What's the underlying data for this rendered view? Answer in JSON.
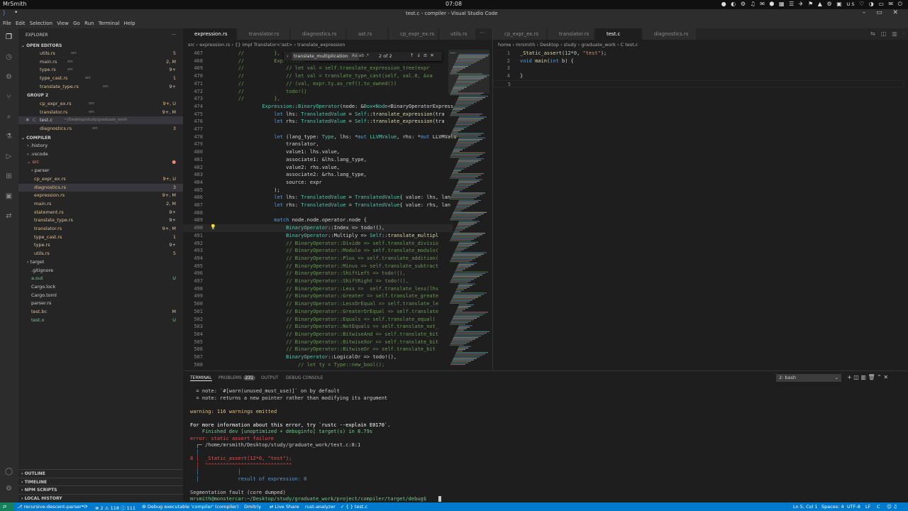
{
  "topbar": {
    "user": "MrSmith",
    "clock": "07:08",
    "tray": "● ◐ ⚙ ♫ ✉ ⬢ ▦ ☰ ✈ ⚑ ▲ ⚙ ▣ us ♡ ◑ ▭ ✉ ⏻"
  },
  "window": {
    "title": "test.c - compiler - Visual Studio Code",
    "controls": "– ▭ ✕"
  },
  "menu": [
    "File",
    "Edit",
    "Selection",
    "View",
    "Go",
    "Run",
    "Terminal",
    "Help"
  ],
  "sidebar": {
    "title": "EXPLORER",
    "more": "···",
    "open_editors_label": "OPEN EDITORS",
    "open_editors": [
      {
        "name": "utils.rs",
        "dir": "src",
        "badge": "5",
        "color": "#e2c08d"
      },
      {
        "name": "main.rs",
        "dir": "src",
        "badge": "2, M",
        "color": "#e2c08d"
      },
      {
        "name": "type.rs",
        "dir": "src",
        "badge": "9+",
        "color": "#e2c08d"
      },
      {
        "name": "type_cast.rs",
        "dir": "src",
        "badge": "1",
        "color": "#e2c08d"
      },
      {
        "name": "translate_type.rs",
        "dir": "src",
        "badge": "9+",
        "color": "#e2c08d"
      }
    ],
    "group2_label": "GROUP 2",
    "group2": [
      {
        "name": "cp_expr_ex.rs",
        "dir": "src",
        "badge": "9+, U",
        "color": "#e2c08d"
      },
      {
        "name": "translator.rs",
        "dir": "src",
        "badge": "9+, M",
        "color": "#e2c08d"
      },
      {
        "name": "test.c",
        "dir": "~/Desktop/study/graduate_work",
        "badge": "",
        "color": "#cccccc"
      },
      {
        "name": "diagnostics.rs",
        "dir": "src",
        "badge": "3",
        "color": "#e2c08d"
      }
    ],
    "compiler_label": "COMPILER",
    "tree": [
      {
        "name": "› .history",
        "badge": "",
        "color": "#cccccc",
        "indent": 12
      },
      {
        "name": "› .vscode",
        "badge": "",
        "color": "#cccccc",
        "indent": 12
      },
      {
        "name": "⌄ src",
        "badge": "●",
        "color": "#f48771",
        "indent": 12
      },
      {
        "name": "› parser",
        "badge": "",
        "color": "#cccccc",
        "indent": 18
      },
      {
        "name": "cp_expr_ex.rs",
        "badge": "9+, U",
        "color": "#e2c08d",
        "indent": 22
      },
      {
        "name": "diagnostics.rs",
        "badge": "3",
        "color": "#e2c08d",
        "indent": 22
      },
      {
        "name": "expression.rs",
        "badge": "9+, M",
        "color": "#e2c08d",
        "indent": 22
      },
      {
        "name": "main.rs",
        "badge": "2, M",
        "color": "#e2c08d",
        "indent": 22
      },
      {
        "name": "statement.rs",
        "badge": "9+",
        "color": "#e2c08d",
        "indent": 22
      },
      {
        "name": "translate_type.rs",
        "badge": "9+",
        "color": "#e2c08d",
        "indent": 22
      },
      {
        "name": "translator.rs",
        "badge": "9+, M",
        "color": "#e2c08d",
        "indent": 22
      },
      {
        "name": "type_cast.rs",
        "badge": "1",
        "color": "#e2c08d",
        "indent": 22
      },
      {
        "name": "type.rs",
        "badge": "9+",
        "color": "#e2c08d",
        "indent": 22
      },
      {
        "name": "utils.rs",
        "badge": "5",
        "color": "#e2c08d",
        "indent": 22
      },
      {
        "name": "› target",
        "badge": "",
        "color": "#cccccc",
        "indent": 12
      },
      {
        "name": ".gitignore",
        "badge": "",
        "color": "#cccccc",
        "indent": 18
      },
      {
        "name": "a.out",
        "badge": "U",
        "color": "#73c991",
        "indent": 18
      },
      {
        "name": "Cargo.lock",
        "badge": "",
        "color": "#cccccc",
        "indent": 18
      },
      {
        "name": "Cargo.toml",
        "badge": "",
        "color": "#cccccc",
        "indent": 18
      },
      {
        "name": "parser.rs",
        "badge": "",
        "color": "#cccccc",
        "indent": 18
      },
      {
        "name": "test.bc",
        "badge": "M",
        "color": "#e2c08d",
        "indent": 18
      },
      {
        "name": "test.o",
        "badge": "U",
        "color": "#73c991",
        "indent": 18
      }
    ],
    "bottom_sections": [
      "OUTLINE",
      "TIMELINE",
      "NPM SCRIPTS",
      "LOCAL HISTORY"
    ]
  },
  "editor1": {
    "tabs": [
      "expression.rs",
      "translator.rs",
      "diagnostics.rs",
      "ast.rs",
      "cp_expr_ex.rs",
      "utils.rs"
    ],
    "breadcrumb": "src  ›  expression.rs  ›  {} impl Translator<'ast>  ›  translate_expression",
    "find": {
      "query": "translate_multiplication",
      "result": "2 of 2",
      "options": "Aa  ab  .*"
    },
    "lines": [
      {
        "n": "467",
        "t": "        //          },"
      },
      {
        "n": "468",
        "t": "        //          Expression::..."
      },
      {
        "n": "469",
        "t": "        //              // let val = self.translate_expression_tree(expr"
      },
      {
        "n": "470",
        "t": "        //              // let val = translate_type_cast(self, val.0, &va"
      },
      {
        "n": "471",
        "t": "        //              // (val, expr.ty.as_ref().to_owned())"
      },
      {
        "n": "472",
        "t": "        //              todo!()"
      },
      {
        "n": "473",
        "t": "        //          },"
      },
      {
        "n": "474",
        "t": "                Expression::BinaryOperator(node: &Box<Node<BinaryOperatorExpress"
      },
      {
        "n": "475",
        "t": "                    let lhs: TranslatedValue = Self::translate_expression(tra"
      },
      {
        "n": "476",
        "t": "                    let rhs: TranslatedValue = Self::translate_expression(tra"
      },
      {
        "n": "477",
        "t": ""
      },
      {
        "n": "478",
        "t": "                    let (lang_type: Type, lhs: *mut LLVMValue, rhs: *mut LLVMValu"
      },
      {
        "n": "479",
        "t": "                        translator,"
      },
      {
        "n": "480",
        "t": "                        value1: lhs.value,"
      },
      {
        "n": "481",
        "t": "                        associate1: &lhs.lang_type,"
      },
      {
        "n": "482",
        "t": "                        value2: rhs.value,"
      },
      {
        "n": "483",
        "t": "                        associate2: &rhs.lang_type,"
      },
      {
        "n": "484",
        "t": "                        source: expr"
      },
      {
        "n": "485",
        "t": "                    );"
      },
      {
        "n": "486",
        "t": "                    let lhs: TranslatedValue = TranslatedValue{ value: lhs, lan"
      },
      {
        "n": "487",
        "t": "                    let rhs: TranslatedValue = TranslatedValue{ value: rhs, lan"
      },
      {
        "n": "488",
        "t": ""
      },
      {
        "n": "489",
        "t": "                    match node.node.operator.node {"
      },
      {
        "n": "490",
        "t": "                        BinaryOperator::Index => todo!(),"
      },
      {
        "n": "491",
        "t": "                        BinaryOperator::Multiply => Self::translate_multipl"
      },
      {
        "n": "492",
        "t": "                        // BinaryOperator::Divide => self.translate_divisio"
      },
      {
        "n": "493",
        "t": "                        // BinaryOperator::Modulo => self.translate_modulo("
      },
      {
        "n": "494",
        "t": "                        // BinaryOperator::Plus => self.translate_addition("
      },
      {
        "n": "495",
        "t": "                        // BinaryOperator::Minus => self.translate_subtract"
      },
      {
        "n": "496",
        "t": "                        // BinaryOperator::ShiftLeft => todo!(),"
      },
      {
        "n": "497",
        "t": "                        // BinaryOperator::ShiftRight => todo!(),"
      },
      {
        "n": "498",
        "t": "                        // BinaryOperator::Less =>  self.translate_less(lhs"
      },
      {
        "n": "499",
        "t": "                        // BinaryOperator::Greater => self.translate_greate"
      },
      {
        "n": "500",
        "t": "                        // BinaryOperator::LessOrEqual => self.translate_le"
      },
      {
        "n": "501",
        "t": "                        // BinaryOperator::GreaterOrEqual => self.translate"
      },
      {
        "n": "502",
        "t": "                        // BinaryOperator::Equals => self.translate_equal("
      },
      {
        "n": "503",
        "t": "                        // BinaryOperator::NotEquals => self.translate_not_"
      },
      {
        "n": "504",
        "t": "                        // BinaryOperator::BitwiseAnd => self.translate_bit"
      },
      {
        "n": "505",
        "t": "                        // BinaryOperator::BitwiseXor => self.translate_bit"
      },
      {
        "n": "506",
        "t": "                        // BinaryOperator::BitwiseOr => self.translate_bit"
      },
      {
        "n": "507",
        "t": "                        BinaryOperator::LogicalOr => todo!(),"
      },
      {
        "n": "508",
        "t": "                            // let ty = Type::new_bool();"
      }
    ]
  },
  "editor2": {
    "tabs": [
      "cp_expr_ex.rs",
      "translator.rs",
      "test.c",
      "diagnostics.rs"
    ],
    "breadcrumb": "home  ›  mrsmith  ›  Desktop  ›  study  ›  graduate_work  ›  C  test.c",
    "lines": [
      {
        "n": "1",
        "t": "_Static_assert(12*0, \"test\");"
      },
      {
        "n": "2",
        "t": "void main(int b) {"
      },
      {
        "n": "3",
        "t": ""
      },
      {
        "n": "4",
        "t": "}"
      },
      {
        "n": "5",
        "t": ""
      }
    ]
  },
  "panel": {
    "tabs": [
      "TERMINAL",
      "PROBLEMS",
      "OUTPUT",
      "DEBUG CONSOLE"
    ],
    "problems_count": "231",
    "shell": "2: bash",
    "shell_options": "⌄",
    "icons": "+   ◫   ▥   🗑   ⌃   ✕",
    "lines": [
      {
        "t": "  = note: `#[warn(unused_must_use)]` on by default",
        "c": "#cccccc"
      },
      {
        "t": "  = note: returns a new pointer rather than modifying its argument",
        "c": "#cccccc"
      },
      {
        "t": "",
        "c": "#cccccc"
      },
      {
        "t": "warning: 116 warnings emitted",
        "c": "#e5c07b"
      },
      {
        "t": "",
        "c": "#cccccc"
      },
      {
        "t": "For more information about this error, try `rustc --explain E0170`.",
        "c": "#ffffff"
      },
      {
        "t": "    Finished dev [unoptimized + debuginfo] target(s) in 8.79s",
        "c": "#73c991"
      },
      {
        "t": "error: static assert failure",
        "c": "#f14c4c"
      },
      {
        "t": "  ┌─ /home/mrsmith/Desktop/study/graduate_work/test.c:8:1",
        "c": "#cccccc"
      },
      {
        "t": "  │",
        "c": "#569cd6"
      },
      {
        "t": "8 │  _Static_assert(12*0, \"test\");",
        "c": "#f14c4c"
      },
      {
        "t": "  │  ^^^^^^^^^^^^^^^^^^^^^^^^^^^^^",
        "c": "#f14c4c"
      },
      {
        "t": "  │             │",
        "c": "#569cd6"
      },
      {
        "t": "  │             result of expression: 0",
        "c": "#569cd6"
      },
      {
        "t": "",
        "c": "#cccccc"
      },
      {
        "t": "Segmentation fault (core dumped)",
        "c": "#cccccc"
      },
      {
        "t": "mrsmith@monstercar:~/Desktop/study/graduate_work/project/compiler/target/debug$ ",
        "c": "#73c991"
      }
    ]
  },
  "status": {
    "remote": "⮂",
    "branch": "⎇ recursive-descent-parser*",
    "sync": "⟳",
    "problems": "⊗ 2 ⚠ 118 ⓘ 111",
    "debug": "⚙ Debug executable 'compiler' (compiler)",
    "user": "👤 Dmitriy",
    "liveshare": "⇄ Live Share",
    "analyzer": "rust-analyzer",
    "file": "✓ { } test.c",
    "position": "Ln 5, Col 1",
    "spaces": "Spaces: 4",
    "encoding": "UTF-8",
    "eol": "LF",
    "lang": "C",
    "feedback": "☺ ♫"
  }
}
